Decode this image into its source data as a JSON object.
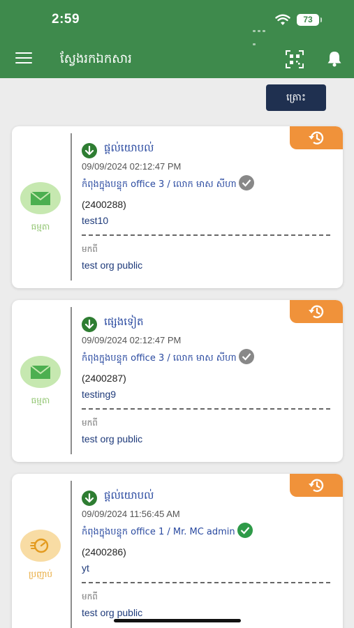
{
  "status_bar": {
    "time": "2:59",
    "battery": "73"
  },
  "header": {
    "title": "ស្វែងរកឯកសារ"
  },
  "filter_button": {
    "label": "ត្រោះ"
  },
  "cards": [
    {
      "type_label": "ធម្មតា",
      "status": "ផ្តល់យោបល់",
      "datetime": "09/09/2024 02:12:47 PM",
      "location": "កំពុងក្នុងបន្ទុក office 3 / លោក មាស សីហា",
      "code": "(2400288)",
      "subject": "test10",
      "from_label": "មកពី",
      "from_org": "test org public"
    },
    {
      "type_label": "ធម្មតា",
      "status": "ផ្សេងទៀត",
      "datetime": "09/09/2024 02:12:47 PM",
      "location": "កំពុងក្នុងបន្ទុក office 3 / លោក មាស សីហា",
      "code": "(2400287)",
      "subject": "testing9",
      "from_label": "មកពី",
      "from_org": "test org public"
    },
    {
      "type_label": "ប្រញាប់",
      "status": "ផ្តល់យោបល់",
      "datetime": "09/09/2024 11:56:45 AM",
      "location": "កំពុងក្នុងបន្ទុក office 1 / Mr. MC admin",
      "code": "(2400286)",
      "subject": "yt",
      "from_label": "មកពី",
      "from_org": "test org public"
    }
  ],
  "colors": {
    "header_green": "#3e8a4c",
    "filter_navy": "#1f3050",
    "history_orange": "#f0923a",
    "link_blue": "#2a4aa0"
  },
  "icons": [
    "menu-icon",
    "qr-scan-icon",
    "bell-icon",
    "envelope-icon",
    "speedometer-icon",
    "history-icon",
    "download-arrow-icon",
    "check-icon"
  ]
}
